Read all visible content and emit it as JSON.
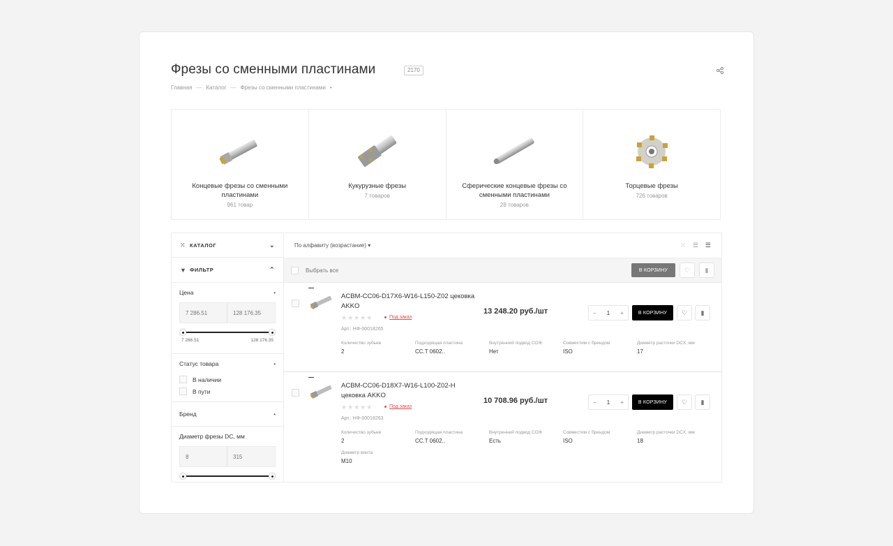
{
  "page": {
    "title": "Фрезы со сменными пластинами",
    "count": "2170"
  },
  "breadcrumb": [
    "Главная",
    "Каталог",
    "Фрезы со сменными пластинами"
  ],
  "categories": [
    {
      "name": "Концевые фрезы со сменными пластинами",
      "count": "961 товар"
    },
    {
      "name": "Кукурузные фрезы",
      "count": "7 товаров"
    },
    {
      "name": "Сферические концевые фрезы со сменными пластинами",
      "count": "28 товаров"
    },
    {
      "name": "Торцевые фрезы",
      "count": "726 товаров"
    }
  ],
  "sidebar": {
    "catalog_label": "КАТАЛОГ",
    "filter_label": "ФИЛЬТР",
    "price": {
      "label": "Цена",
      "min_placeholder": "7 286.51",
      "max_placeholder": "128 176.35",
      "min_label": "7 286.51",
      "max_label": "128 176.35"
    },
    "status": {
      "label": "Статус товара",
      "options": [
        "В наличии",
        "В пути"
      ]
    },
    "brand_label": "Бренд",
    "diameter": {
      "label": "Диаметр фрезы DC, мм",
      "min_placeholder": "8",
      "max_placeholder": "315",
      "min_label": "8",
      "max_label": "315"
    }
  },
  "toolbar": {
    "sort_label": "По алфавиту (возрастание)",
    "select_all": "Выбрать все",
    "to_cart": "В КОРЗИНУ"
  },
  "products": [
    {
      "title": "ACBM-CC06-D17X6-W16-L150-Z02 цековка AKKO",
      "stars": "★★★★★",
      "status": "Под заказ",
      "sku": "Арт.: НФ-00018265",
      "price": "13 248.20 руб./шт",
      "qty": "1",
      "cart": "В КОРЗИНУ",
      "props": [
        {
          "name": "Количество зубьев",
          "value": "2"
        },
        {
          "name": "Подходящая пластина",
          "value": "CC.T 0602.."
        },
        {
          "name": "Внутренний подвод СОЖ",
          "value": "Нет"
        },
        {
          "name": "Совместим с брендом",
          "value": "ISO"
        },
        {
          "name": "Диаметр расточки DCX, мм",
          "value": "17"
        }
      ]
    },
    {
      "title": "ACBM-CC06-D18X7-W16-L100-Z02-H цековка AKKO",
      "stars": "★★★★★",
      "status": "Под заказ",
      "sku": "Арт.: НФ-00018263",
      "price": "10 708.96 руб./шт",
      "qty": "1",
      "cart": "В КОРЗИНУ",
      "props": [
        {
          "name": "Количество зубьев",
          "value": "2"
        },
        {
          "name": "Подходящая пластина",
          "value": "CC.T 0602.."
        },
        {
          "name": "Внутренний подвод СОЖ",
          "value": "Есть"
        },
        {
          "name": "Совместим с брендом",
          "value": "ISO"
        },
        {
          "name": "Диаметр расточки DCX, мм",
          "value": "18"
        },
        {
          "name": "Диаметр винта",
          "value": "M10"
        }
      ]
    }
  ],
  "icons": {
    "share": "share-icon",
    "heart": "heart-icon",
    "compare": "compare-icon"
  }
}
